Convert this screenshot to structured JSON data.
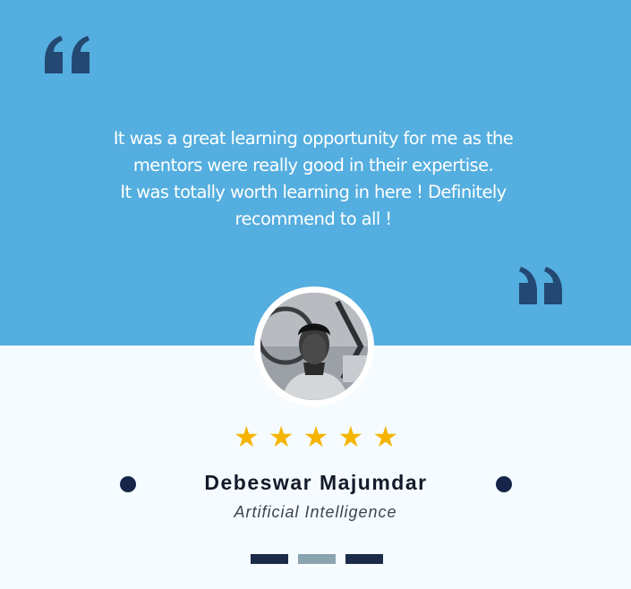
{
  "testimonial": {
    "quote_lines": [
      "It was a great learning opportunity for me as the",
      "mentors were really good in their expertise.",
      "It was totally worth learning in here ! Definitely",
      "recommend to all !"
    ],
    "rating": 5,
    "name": "Debeswar Majumdar",
    "role": "Artificial Intelligence"
  },
  "pagination": {
    "pages": 3,
    "active_index": 1
  },
  "icons": {
    "open_quote": "open-quote-icon",
    "close_quote": "close-quote-icon",
    "star": "star-icon"
  },
  "colors": {
    "top_bg": "#54aedf",
    "bottom_bg": "#f5fbfe",
    "quote_mark": "#234872",
    "star": "#f4b400",
    "dot": "#15254a",
    "bar_dark": "#1a2b4a",
    "bar_active": "#8aa3b0"
  }
}
